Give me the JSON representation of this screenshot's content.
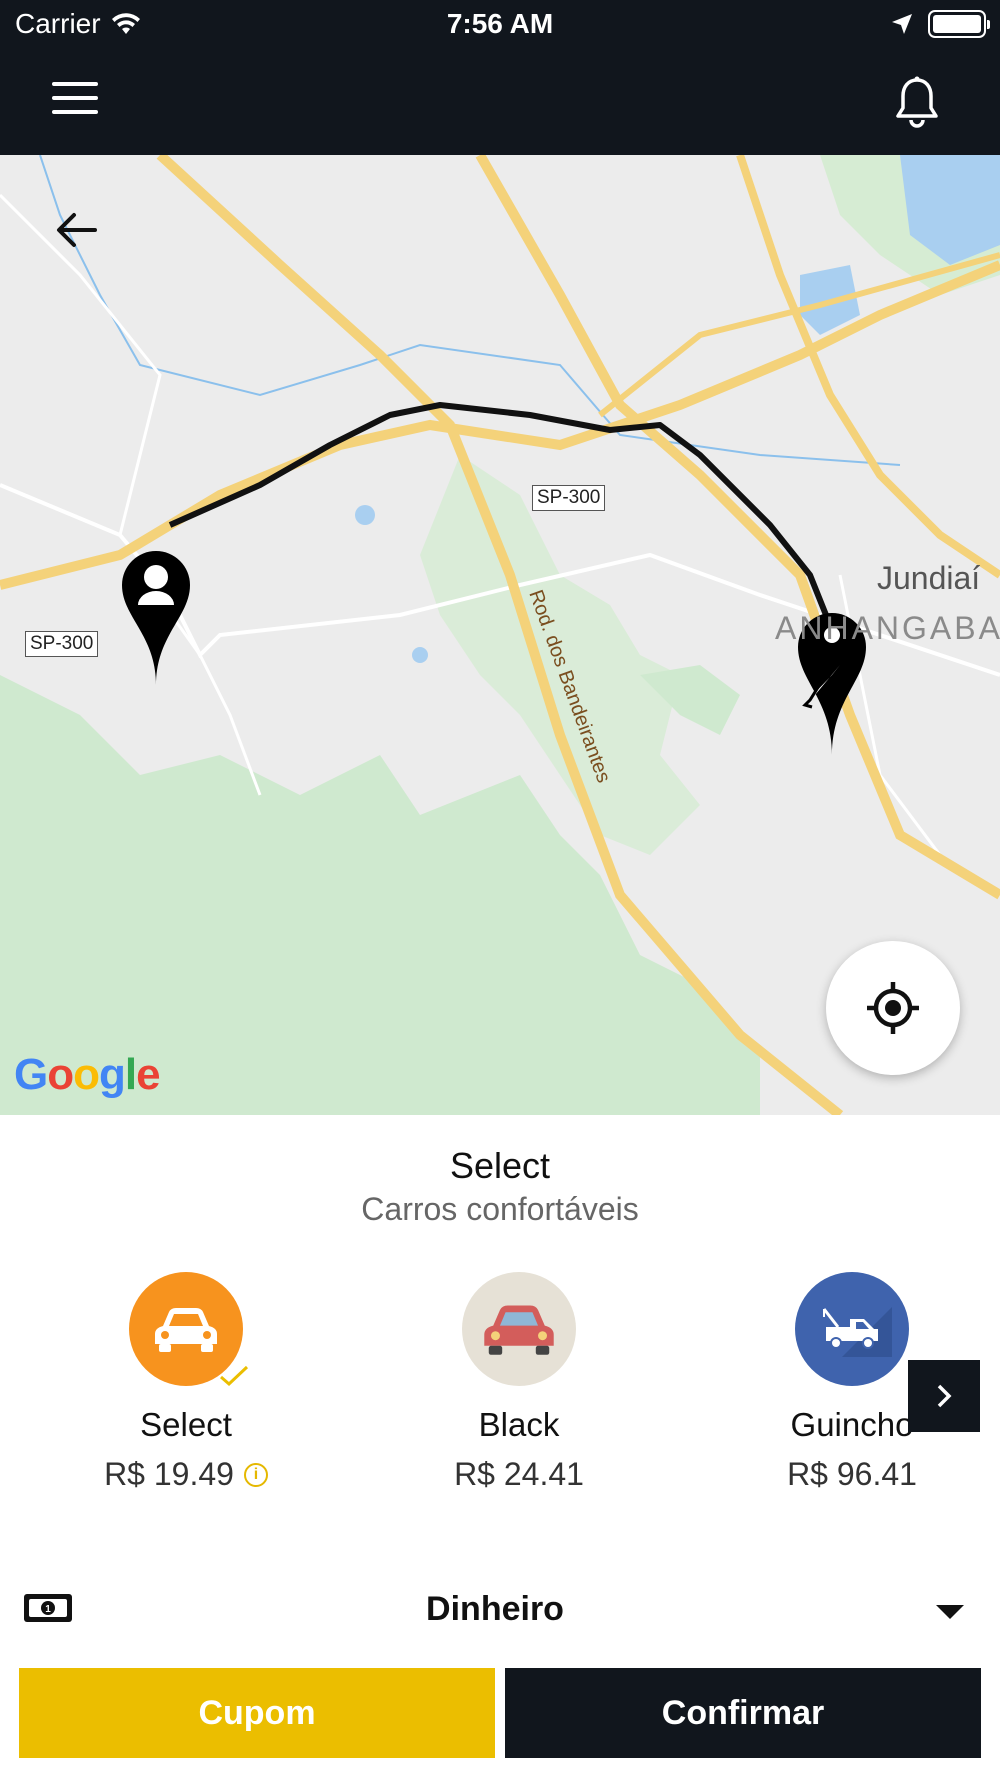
{
  "status_bar": {
    "carrier": "Carrier",
    "time": "7:56 AM"
  },
  "map": {
    "road_shield_1": "SP-300",
    "road_shield_2": "SP-300",
    "city_label": "Jundiaí",
    "district_label": "ANHANGABA",
    "road_label": "Rod. dos Bandeirantes",
    "attribution": "Google"
  },
  "sheet": {
    "title": "Select",
    "subtitle": "Carros confortáveis",
    "vehicles": [
      {
        "name": "Select",
        "price": "R$ 19.49",
        "color": "#f7931e",
        "selected": true
      },
      {
        "name": "Black",
        "price": "R$ 24.41",
        "color": "#e6e1d6",
        "selected": false
      },
      {
        "name": "Guincho",
        "price": "R$ 96.41",
        "color": "#3f63ad",
        "selected": false
      }
    ],
    "payment": {
      "label": "Dinheiro"
    },
    "buttons": {
      "coupon": "Cupom",
      "confirm": "Confirmar"
    }
  },
  "colors": {
    "dark": "#11161d",
    "accent": "#ebbe00"
  }
}
